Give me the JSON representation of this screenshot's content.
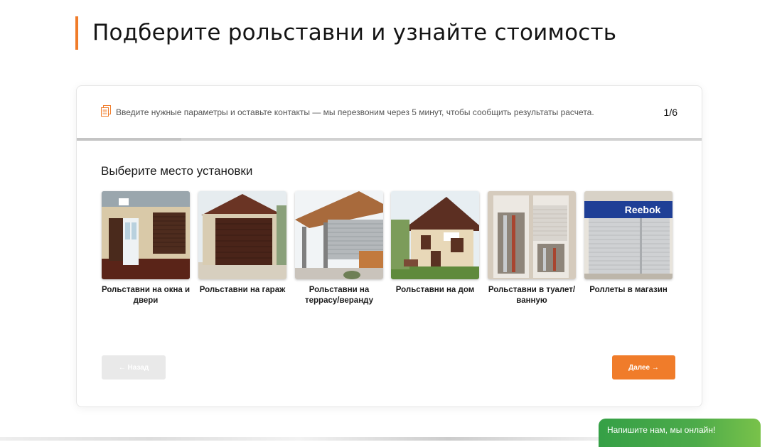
{
  "page": {
    "title": "Подберите рольставни и узнайте стоимость"
  },
  "quiz": {
    "hint": "Введите нужные параметры и оставьте контакты — мы перезвоним через 5 минут, чтобы сообщить результаты расчета.",
    "step_counter": "1/6",
    "progress": 0.1667,
    "question": "Выберите место установки",
    "options": [
      {
        "label": "Рольставни на окна и двери",
        "icon": "window-door-shutters-photo"
      },
      {
        "label": "Рольставни на гараж",
        "icon": "garage-shutters-photo"
      },
      {
        "label": "Рольставни на террасу/веранду",
        "icon": "terrace-shutters-photo"
      },
      {
        "label": "Рольставни на дом",
        "icon": "house-shutters-photo"
      },
      {
        "label": "Рольставни в туалет/ванную",
        "icon": "bathroom-shutters-photo"
      },
      {
        "label": "Роллеты в магазин",
        "icon": "shop-shutters-photo",
        "sign_text": "Reebok"
      }
    ],
    "back_label": "← Назад",
    "next_label": "Далее →"
  },
  "chat": {
    "label": "Напишите нам, мы онлайн!"
  },
  "colors": {
    "accent": "#f07c2a",
    "chat": "#3ea346",
    "back_disabled": "#e9e9e9"
  }
}
